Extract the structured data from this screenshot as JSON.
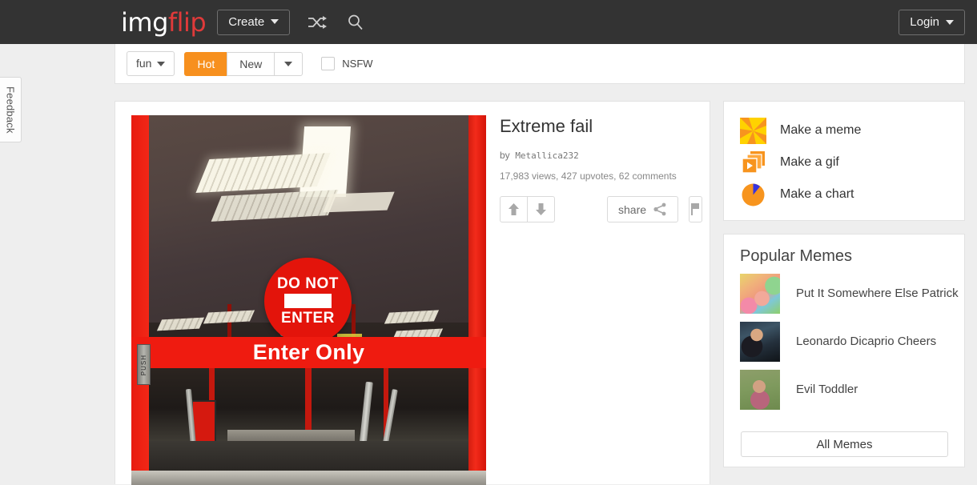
{
  "header": {
    "logo_img": "img",
    "logo_flip": "flip",
    "create_label": "Create",
    "shuffle_icon": "shuffle-icon",
    "search_icon": "search-icon",
    "login_label": "Login"
  },
  "feedback": {
    "label": "Feedback"
  },
  "filter_bar": {
    "category": "fun",
    "sort_hot": "Hot",
    "sort_new": "New",
    "nsfw_label": "NSFW",
    "nsfw_checked": false,
    "accent_color": "#f7901e"
  },
  "post": {
    "title": "Extreme fail",
    "by_prefix": "by",
    "author": "Metallica232",
    "stats": "17,983 views, 427 upvotes, 62 comments",
    "upvote_icon": "arrow-up-icon",
    "downvote_icon": "arrow-down-icon",
    "share_label": "share",
    "share_icon": "share-nodes-icon",
    "flag_icon": "flag-icon",
    "image": {
      "alt": "red store entrance doors with DO NOT ENTER sign",
      "sign_line1": "DO NOT",
      "sign_line2": "ENTER",
      "banner_text": "Enter Only",
      "push_plate_text": "PUSH"
    }
  },
  "make_panel": {
    "items": [
      {
        "label": "Make a meme",
        "icon": "pinwheel-icon"
      },
      {
        "label": "Make a gif",
        "icon": "gif-frames-play-icon"
      },
      {
        "label": "Make a chart",
        "icon": "pie-chart-icon"
      }
    ]
  },
  "popular_memes": {
    "title": "Popular Memes",
    "items": [
      {
        "name": "Put It Somewhere Else Patrick",
        "thumb": "patrick-thumbnail"
      },
      {
        "name": "Leonardo Dicaprio Cheers",
        "thumb": "leonardo-thumbnail"
      },
      {
        "name": "Evil Toddler",
        "thumb": "toddler-thumbnail"
      }
    ],
    "all_memes_label": "All Memes"
  },
  "colors": {
    "header_bg": "#333333",
    "page_bg": "#eeeeee",
    "panel_bg": "#ffffff",
    "brand_red": "#e03a3a",
    "accent_orange": "#f7901e"
  }
}
